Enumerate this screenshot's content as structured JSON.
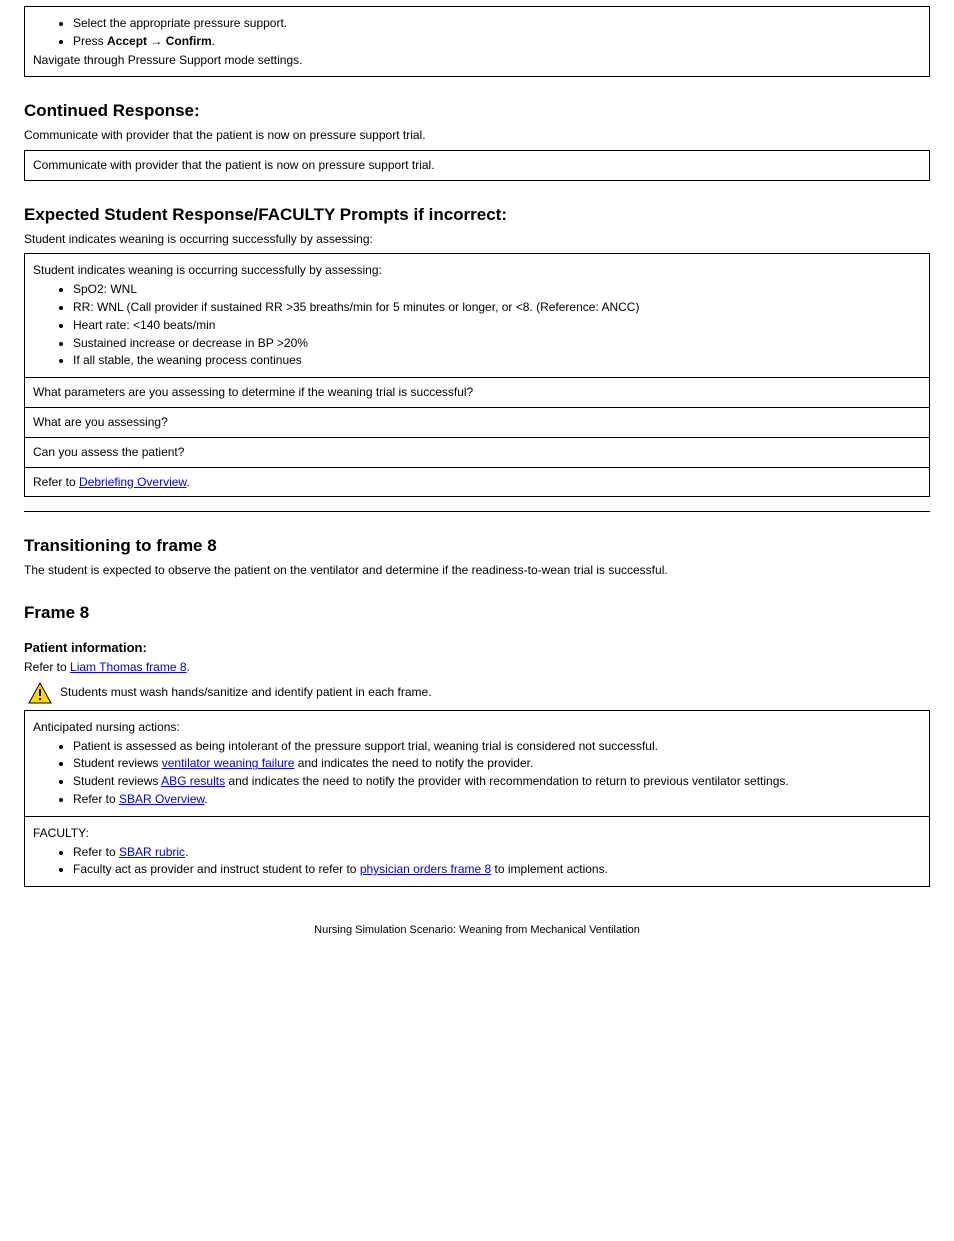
{
  "top_box": {
    "bullets": [
      "Select the appropriate pressure support.",
      [
        "Press ",
        "Accept",
        " → ",
        "Confirm",
        "."
      ]
    ],
    "post": "Navigate through Pressure Support mode settings."
  },
  "cont7": {
    "heading": "Continued Response:",
    "line": "Communicate with provider that the patient is now on pressure support trial."
  },
  "cont7_expected": {
    "heading": "Expected Student Response/FACULTY Prompts if incorrect:",
    "lead": "Student indicates weaning is occurring successfully by assessing:",
    "bullets": [
      "SpO2: WNL",
      "RR: WNL (Call provider if sustained RR >35 breaths/min for 5 minutes or longer, or <8. (Reference: ANCC)",
      "Heart rate: <140 beats/min",
      "Sustained increase or decrease in BP >20%",
      "If all stable, the weaning process continues"
    ],
    "rows": [
      "What parameters are you assessing to determine if the weaning trial is successful?",
      "What are you assessing?",
      "Can you assess the patient?"
    ],
    "link_row": [
      "Refer to ",
      "Debriefing Overview",
      "."
    ]
  },
  "transition": {
    "heading": "Transitioning to frame 8",
    "text": "The student is expected to observe the patient on the ventilator and determine if the readiness-to-wean trial is successful."
  },
  "frame8": {
    "heading": "Frame 8",
    "info_label": "Patient information:",
    "info_link_text": "Liam Thomas frame 8",
    "info_trail": "."
  },
  "warning": "Students must wash hands/sanitize and identify patient in each frame.",
  "actions_box": {
    "lead": "Anticipated nursing actions:",
    "items": [
      {
        "text": "Patient is assessed as being intolerant of the pressure support trial, weaning trial is considered not successful."
      },
      {
        "pre": "Student reviews ",
        "link": "ventilator weaning failure",
        "post": " and indicates the need to notify the provider."
      },
      {
        "pre": "Student reviews ",
        "link": "ABG results",
        "post": " and indicates the need to notify the provider with recommendation to return to previous ventilator settings."
      },
      {
        "pre": "Refer to ",
        "link": "SBAR Overview",
        "post": "."
      }
    ]
  },
  "faculty_box": {
    "lead": "FACULTY:",
    "items": [
      {
        "pre": "Refer to ",
        "link": "SBAR rubric",
        "post": "."
      },
      {
        "pre": "Faculty act as provider and instruct student to refer to ",
        "link": "physician orders frame 8",
        "post": " to implement actions."
      }
    ]
  },
  "footer": "Nursing Simulation Scenario: Weaning from Mechanical Ventilation"
}
